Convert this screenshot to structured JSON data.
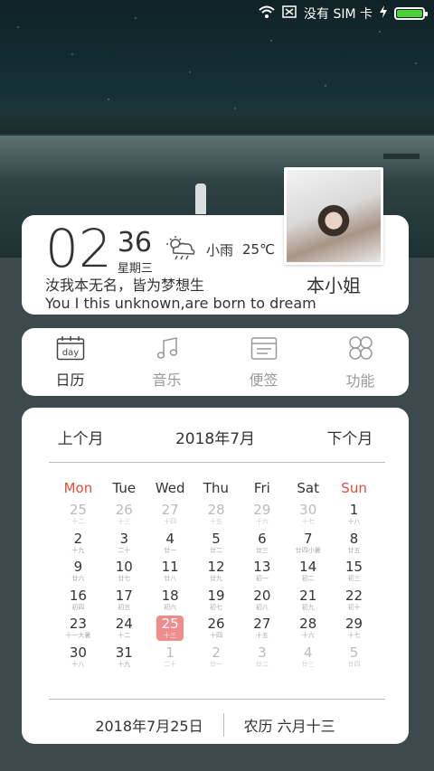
{
  "status": {
    "no_sim_label": "没有 SIM 卡"
  },
  "info": {
    "hour": "02",
    "minute": "36",
    "weekday": "星期三",
    "weather_text": "小雨",
    "temperature": "25℃",
    "motto_cn": "汝我本无名，皆为梦想生",
    "motto_en": "You I this unknown,are born to dream",
    "name": "本小姐"
  },
  "nav": {
    "items": [
      {
        "label": "日历",
        "icon_text": "day"
      },
      {
        "label": "音乐"
      },
      {
        "label": "便签"
      },
      {
        "label": "功能"
      }
    ]
  },
  "calendar": {
    "prev": "上个月",
    "current": "2018年7月",
    "next": "下个月",
    "weekdays": [
      "Mon",
      "Tue",
      "Wed",
      "Thu",
      "Fri",
      "Sat",
      "Sun"
    ],
    "weeks": [
      [
        [
          "25",
          "十二",
          1
        ],
        [
          "26",
          "十三",
          1
        ],
        [
          "27",
          "十四",
          1
        ],
        [
          "28",
          "十五",
          1
        ],
        [
          "29",
          "十六",
          1
        ],
        [
          "30",
          "十七",
          1
        ],
        [
          "1",
          "十八",
          0
        ]
      ],
      [
        [
          "2",
          "十九",
          0
        ],
        [
          "3",
          "二十",
          0
        ],
        [
          "4",
          "廿一",
          0
        ],
        [
          "5",
          "廿二",
          0
        ],
        [
          "6",
          "廿三",
          0
        ],
        [
          "7",
          "廿四小暑",
          0
        ],
        [
          "8",
          "廿五",
          0
        ]
      ],
      [
        [
          "9",
          "廿六",
          0
        ],
        [
          "10",
          "廿七",
          0
        ],
        [
          "11",
          "廿八",
          0
        ],
        [
          "12",
          "廿九",
          0
        ],
        [
          "13",
          "初一",
          0
        ],
        [
          "14",
          "初二",
          0
        ],
        [
          "15",
          "初三",
          0
        ]
      ],
      [
        [
          "16",
          "初四",
          0
        ],
        [
          "17",
          "初五",
          0
        ],
        [
          "18",
          "初六",
          0
        ],
        [
          "19",
          "初七",
          0
        ],
        [
          "20",
          "初八",
          0
        ],
        [
          "21",
          "初九",
          0
        ],
        [
          "22",
          "初十",
          0
        ]
      ],
      [
        [
          "23",
          "十一大暑",
          0
        ],
        [
          "24",
          "十二",
          0
        ],
        [
          "25",
          "十三",
          2
        ],
        [
          "26",
          "十四",
          0
        ],
        [
          "27",
          "十五",
          0
        ],
        [
          "28",
          "十六",
          0
        ],
        [
          "29",
          "十七",
          0
        ]
      ],
      [
        [
          "30",
          "十八",
          0
        ],
        [
          "31",
          "十九",
          0
        ],
        [
          "1",
          "二十",
          1
        ],
        [
          "2",
          "廿一",
          1
        ],
        [
          "3",
          "廿二",
          1
        ],
        [
          "4",
          "廿三",
          1
        ],
        [
          "5",
          "廿四",
          1
        ]
      ]
    ],
    "footer_date": "2018年7月25日",
    "footer_lunar": "农历 六月十三"
  }
}
